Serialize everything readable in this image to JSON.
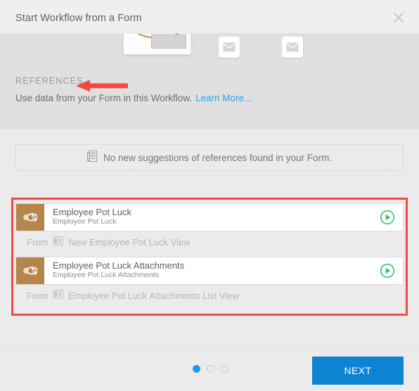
{
  "dialog": {
    "title": "Start Workflow from a Form",
    "close_icon": "close-icon"
  },
  "references": {
    "heading": "REFERENCES",
    "subtitle": "Use data from your Form in this Workflow.",
    "learn_more": "Learn More...",
    "suggestion_message": "No new suggestions of references found in your Form.",
    "suggestion_icon": "form-document-icon",
    "items": [
      {
        "name": "Employee Pot Luck",
        "description": "Employee Pot Luck",
        "icon": "workflow-reference-icon",
        "run_icon": "play-icon",
        "from_label": "From",
        "from_view_icon": "list-view-icon",
        "from_view": "New Employee Pot Luck View"
      },
      {
        "name": "Employee Pot Luck Attachments",
        "description": "Employee Pot Luck Attachments",
        "icon": "workflow-reference-icon",
        "run_icon": "play-icon",
        "from_label": "From",
        "from_view_icon": "list-view-icon",
        "from_view": "Employee Pot Luck Attachments List View"
      }
    ]
  },
  "top_strip": {
    "cards": [
      {
        "type": "form-card"
      },
      {
        "type": "email-card",
        "icon": "envelope-icon"
      },
      {
        "type": "email-card",
        "icon": "envelope-icon"
      }
    ]
  },
  "footer": {
    "next_label": "NEXT",
    "pagination": {
      "total": 3,
      "active": 1
    }
  },
  "annotations": {
    "arrow_color": "#f04a42",
    "rect_color": "#f04a42"
  },
  "colors": {
    "accent_blue": "#0c84d1",
    "link_blue": "#2da0e8",
    "icon_brown": "#b5854c",
    "play_green": "#3bc070",
    "annotation_red": "#f04a42"
  }
}
